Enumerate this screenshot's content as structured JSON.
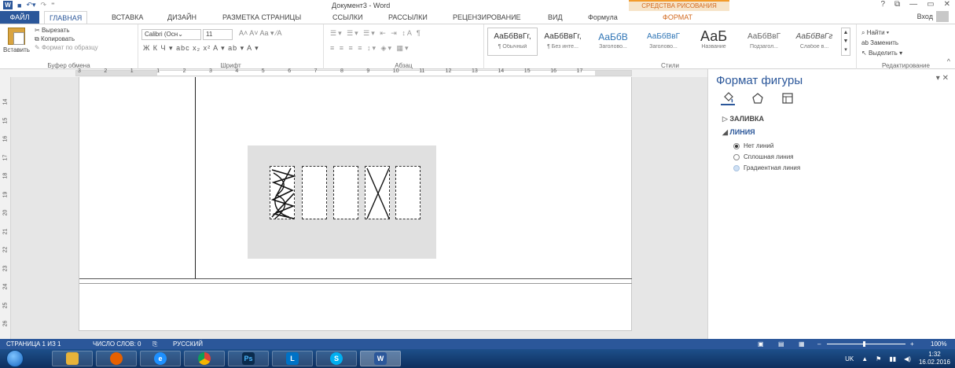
{
  "titlebar": {
    "title": "Документ3 - Word",
    "context_group": "СРЕДСТВА РИСОВАНИЯ",
    "help": "?",
    "restore": "⧉",
    "minimize": "—",
    "maximize": "▭",
    "close": "✕"
  },
  "tabs": {
    "file": "ФАЙЛ",
    "home": "ГЛАВНАЯ",
    "insert": "ВСТАВКА",
    "design": "ДИЗАЙН",
    "layout": "РАЗМЕТКА СТРАНИЦЫ",
    "references": "ССЫЛКИ",
    "mailings": "РАССЫЛКИ",
    "review": "РЕЦЕНЗИРОВАНИЕ",
    "view": "ВИД",
    "formula": "Формула",
    "format": "ФОРМАТ",
    "signin": "Вход"
  },
  "ribbon": {
    "clipboard": {
      "paste": "Вставить",
      "cut": "Вырезать",
      "copy": "Копировать",
      "format_painter": "Формат по образцу",
      "label": "Буфер обмена"
    },
    "font": {
      "name": "Calibri (Осн⌄",
      "size": "11",
      "row1": "A˄ A˅  Aa ▾   ⁄A",
      "row2": "Ж  К  Ч ▾ abc x₂ x²   A ▾  ab ▾  A ▾",
      "label": "Шрифт"
    },
    "paragraph": {
      "row1": "☰▾ ☰▾ ☰▾  ⇤ ⇥  ↕A  ¶",
      "row2": "≡ ≡ ≡ ≡  ↕▾  ◈▾ ▦▾",
      "label": "Абзац"
    },
    "styles": {
      "items": [
        {
          "sample": "АаБбВвГг,",
          "name": "¶ Обычный"
        },
        {
          "sample": "АаБбВвГг,",
          "name": "¶ Без инте..."
        },
        {
          "sample": "АаБбВ",
          "name": "Заголово..."
        },
        {
          "sample": "АаБбВвГ",
          "name": "Заголово..."
        },
        {
          "sample": "АаБ",
          "name": "Название"
        },
        {
          "sample": "АаБбВвГ",
          "name": "Подзагол..."
        },
        {
          "sample": "АаБбВвГг",
          "name": "Слабое в..."
        }
      ],
      "label": "Стили"
    },
    "editing": {
      "find": "Найти",
      "replace": "Заменить",
      "select": "Выделить",
      "label": "Редактирование"
    }
  },
  "ruler": {
    "numbers": [
      "3",
      "2",
      "1",
      "1",
      "2",
      "3",
      "4",
      "5",
      "6",
      "7",
      "8",
      "9",
      "10",
      "11",
      "12",
      "13",
      "14",
      "15",
      "16",
      "17"
    ],
    "vertical": [
      "14",
      "15",
      "16",
      "17",
      "18",
      "19",
      "20",
      "21",
      "22",
      "23",
      "24",
      "25",
      "26",
      "27"
    ]
  },
  "pane": {
    "title": "Формат фигуры",
    "close": "✕",
    "fill_section": "ЗАЛИВКА",
    "line_section": "ЛИНИЯ",
    "options": [
      "Нет линий",
      "Сплошная линия",
      "Градиентная линия"
    ],
    "selected_option": "Нет линий"
  },
  "statusbar": {
    "page": "СТРАНИЦА 1 ИЗ 1",
    "words": "ЧИСЛО СЛОВ: 0",
    "language": "РУССКИЙ",
    "zoom": "100%"
  },
  "taskbar": {
    "lang": "UK",
    "time": "1:32",
    "date": "16.02.2016"
  },
  "colors": {
    "accent": "#2b579a",
    "context_tab": "#d2691e"
  }
}
